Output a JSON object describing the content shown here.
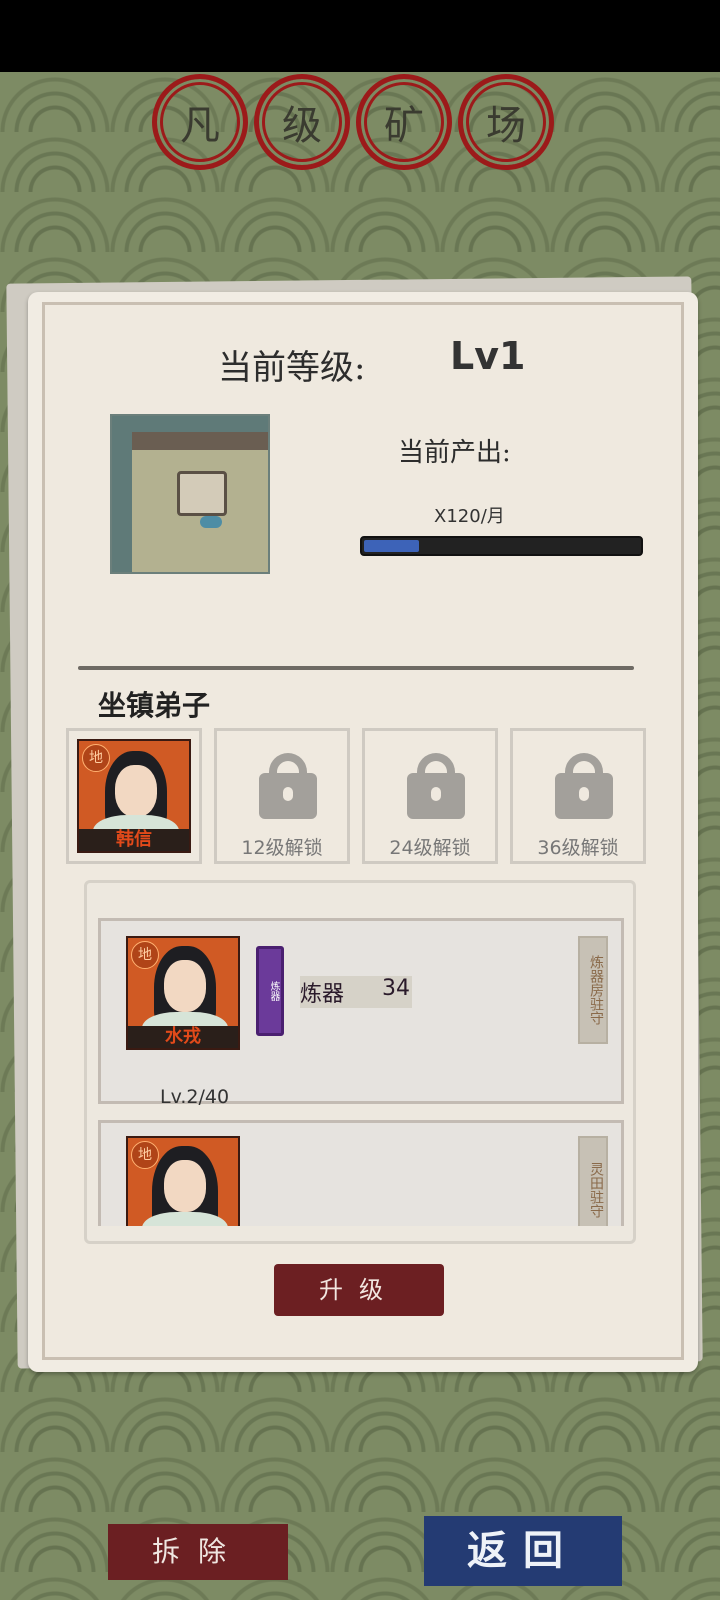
{
  "title": {
    "chars": [
      "凡",
      "级",
      "矿",
      "场"
    ]
  },
  "level": {
    "label": "当前等级:",
    "value": "Lv1"
  },
  "output": {
    "label": "当前产出:",
    "value": "X120/月",
    "progress": 0.2
  },
  "guard": {
    "title": "坐镇弟子",
    "slots": [
      {
        "name": "韩信",
        "rank": "地"
      },
      {
        "lock_text": "12级解锁"
      },
      {
        "lock_text": "24级解锁"
      },
      {
        "lock_text": "36级解锁"
      }
    ]
  },
  "disciples": [
    {
      "name": "水戎",
      "rank": "地",
      "tag": "炼器",
      "skill": "炼器",
      "skill_value": "34",
      "level": "Lv.2/40",
      "side_tag": "炼器房驻守"
    },
    {
      "name": "",
      "rank": "地",
      "side_tag": "灵田驻守"
    }
  ],
  "buttons": {
    "upgrade": "升级",
    "demolish": "拆除",
    "return": "返回"
  },
  "colors": {
    "seal_red": "#9c1a1a",
    "progress_blue": "#3d63b8",
    "upgrade_btn": "#6c1f22",
    "return_btn": "#243b73"
  }
}
